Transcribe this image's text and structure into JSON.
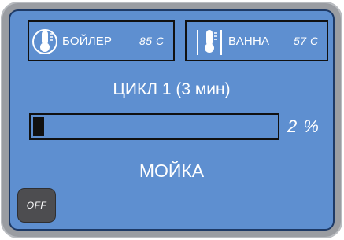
{
  "sensors": {
    "boiler": {
      "label": "БОЙЛЕР",
      "value": "85 С",
      "icon": "thermometer-icon"
    },
    "bath": {
      "label": "ВАННА",
      "value": "57 С",
      "icon": "thermometer-icon"
    }
  },
  "cycle": {
    "title": "ЦИКЛ 1 (3 мин)"
  },
  "progress": {
    "percent": 2,
    "text": "2 %"
  },
  "mode": {
    "label": "МОЙКА"
  },
  "controls": {
    "off_label": "OFF"
  },
  "colors": {
    "screen": "#5e8fd0",
    "bezel": "#9a9da2",
    "text": "#ffffff",
    "outline": "#111111",
    "off_button": "#4d4d50"
  }
}
